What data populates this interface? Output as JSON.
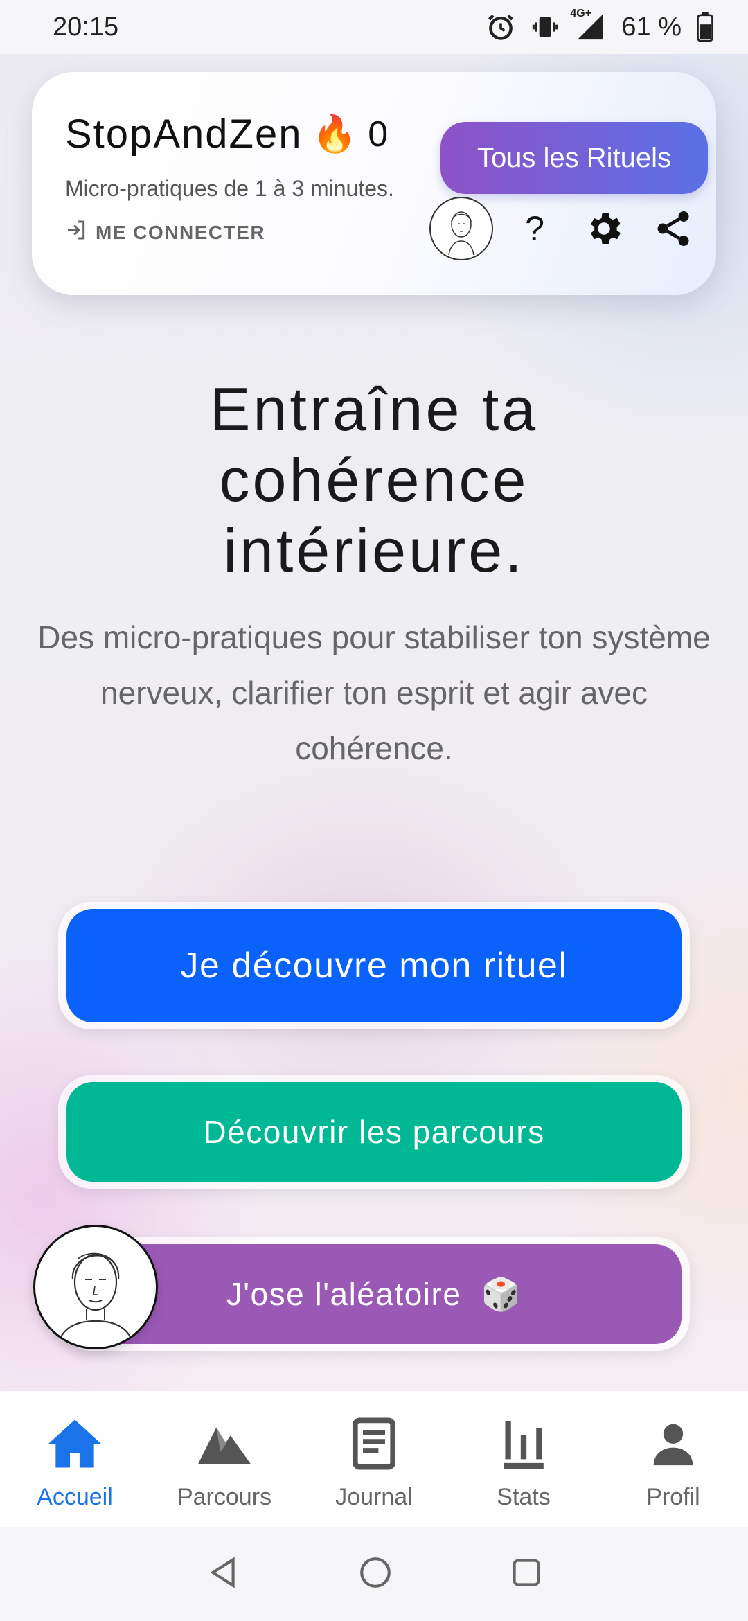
{
  "status_bar": {
    "time": "20:15",
    "network": "4G+",
    "battery": "61 %"
  },
  "header": {
    "app_name": "StopAndZen",
    "flame_emoji": "🔥",
    "streak_count": "0",
    "tagline": "Micro-pratiques de 1 à 3 minutes.",
    "login_label": "ME CONNECTER",
    "all_rituals_label": "Tous les Rituels",
    "help_label": "?"
  },
  "hero": {
    "title": "Entraîne ta cohérence intérieure.",
    "subtitle": "Des micro-pratiques pour stabiliser ton système nerveux, clarifier ton esprit et agir avec cohérence."
  },
  "actions": {
    "discover_ritual": "Je découvre mon rituel",
    "discover_paths": "Découvrir les parcours",
    "random": "J'ose l'aléatoire",
    "random_emoji": "🎲"
  },
  "bottom_nav": {
    "items": [
      {
        "label": "Accueil",
        "icon": "home-icon",
        "active": true
      },
      {
        "label": "Parcours",
        "icon": "mountain-icon",
        "active": false
      },
      {
        "label": "Journal",
        "icon": "journal-icon",
        "active": false
      },
      {
        "label": "Stats",
        "icon": "stats-icon",
        "active": false
      },
      {
        "label": "Profil",
        "icon": "person-icon",
        "active": false
      }
    ]
  },
  "colors": {
    "primary_button": "#0a62fb",
    "green_button": "#00b894",
    "purple_button": "#9b59b6",
    "active_nav": "#1a73e8"
  }
}
